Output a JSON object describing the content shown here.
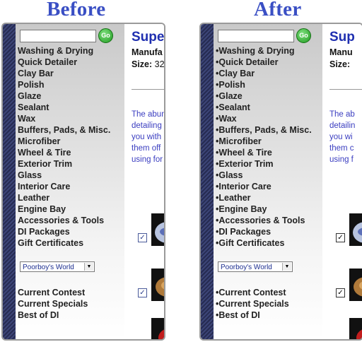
{
  "headings": {
    "before": "Before",
    "after": "After"
  },
  "search": {
    "go_label": "Go"
  },
  "before": {
    "menu": [
      "Washing & Drying",
      "Quick Detailer",
      "Clay Bar",
      "Polish",
      "Glaze",
      "Sealant",
      "Wax",
      "Buffers, Pads, & Misc.",
      "Microfiber",
      "Wheel & Tire",
      "Exterior Trim",
      "Glass",
      "Interior Care",
      "Leather",
      "Engine Bay",
      "Accessories & Tools",
      "DI Packages",
      "Gift Certificates"
    ],
    "select_value": "Poorboy's World",
    "menu2": [
      "Current Contest",
      "Current Specials",
      "Best of DI"
    ]
  },
  "after": {
    "menu": [
      "•Washing & Drying",
      "•Quick Detailer",
      "•Clay Bar",
      "•Polish",
      "•Glaze",
      "•Sealant",
      "•Wax",
      "•Buffers, Pads, & Misc.",
      "•Microfiber",
      "•Wheel & Tire",
      "•Exterior Trim",
      "•Glass",
      "•Interior Care",
      "•Leather",
      "•Engine Bay",
      "•Accessories & Tools",
      "•DI Packages",
      "•Gift Certificates"
    ],
    "select_value": "Poorboy's World",
    "menu2": [
      "•Current Contest",
      "•Current Specials",
      "•Best of DI"
    ]
  },
  "product_before": {
    "title": "Supe",
    "manufacturer": "Manufa",
    "size_label": "Size:",
    "size_value": "32",
    "desc": [
      "The abun",
      "detailing",
      "you with",
      "them off",
      "using for"
    ]
  },
  "product_after": {
    "title": "Sup",
    "manufacturer": "Manu",
    "size_label": "Size:",
    "size_value": "",
    "desc": [
      "The ab",
      "detailin",
      "you wi",
      "them c",
      "using f"
    ]
  },
  "colors": {
    "heading": "#3a4fc4",
    "title": "#1f2fb0",
    "link": "#3a3dc0"
  }
}
